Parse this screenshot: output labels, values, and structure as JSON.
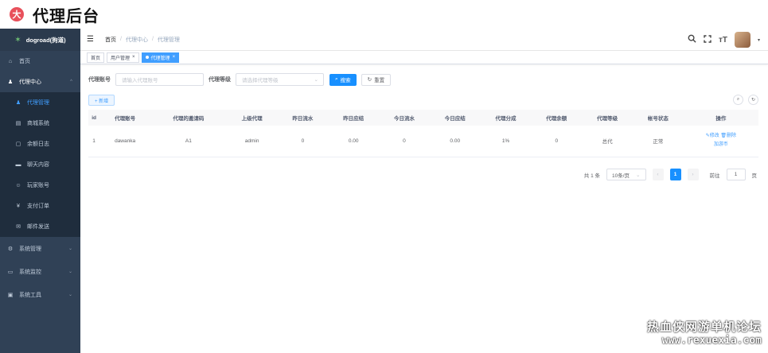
{
  "header": {
    "logo_char": "大",
    "title": "代理后台"
  },
  "sidebar": {
    "brand": "dogroad(狗道)",
    "items": [
      {
        "label": "首页",
        "icon": "dashboard-icon",
        "glyph": "⌂"
      },
      {
        "label": "代理中心",
        "icon": "user-icon",
        "glyph": "♟",
        "arrow": "^"
      },
      {
        "label": "系统管理",
        "icon": "gear-icon",
        "glyph": "⚙",
        "arrow": "⌄"
      },
      {
        "label": "系统监控",
        "icon": "monitor-icon",
        "glyph": "▭",
        "arrow": "⌄"
      },
      {
        "label": "系统工具",
        "icon": "toolbox-icon",
        "glyph": "▣",
        "arrow": "⌄"
      }
    ],
    "sub_items": [
      {
        "label": "代理管理",
        "icon": "user-icon",
        "glyph": "♟"
      },
      {
        "label": "商城系统",
        "icon": "cart-icon",
        "glyph": "▤"
      },
      {
        "label": "余额日志",
        "icon": "log-icon",
        "glyph": "▢"
      },
      {
        "label": "聊天内容",
        "icon": "chat-icon",
        "glyph": "▬"
      },
      {
        "label": "玩家账号",
        "icon": "player-icon",
        "glyph": "☺"
      },
      {
        "label": "支付订单",
        "icon": "yen-icon",
        "glyph": "¥"
      },
      {
        "label": "邮件发送",
        "icon": "mail-icon",
        "glyph": "✉"
      }
    ]
  },
  "topbar": {
    "breadcrumb": [
      "首页",
      "代理中心",
      "代理管理"
    ],
    "separator": "/"
  },
  "tags": {
    "items": [
      "首页",
      "用户管理"
    ],
    "active": "代理管理",
    "close": "×"
  },
  "filter": {
    "account_label": "代理账号",
    "account_placeholder": "请输入代理账号",
    "level_label": "代理等级",
    "level_placeholder": "请选择代理等级",
    "search_btn": "搜索",
    "reset_btn": "重置"
  },
  "toolbar": {
    "add_btn": "+ 新增"
  },
  "table": {
    "columns": [
      "id",
      "代理账号",
      "代理的邀请码",
      "上级代理",
      "昨日流水",
      "昨日应结",
      "今日流水",
      "今日应结",
      "代理分成",
      "代理余额",
      "代理等级",
      "帐号状态",
      "操作"
    ],
    "rows": [
      {
        "id": "1",
        "account": "dawanka",
        "invite": "A1",
        "parent": "admin",
        "yday_flow": "0",
        "yday_settle": "0.00",
        "today_flow": "0",
        "today_settle": "0.00",
        "share": "1%",
        "balance": "0",
        "level": "总代",
        "status": "正常",
        "op_edit": "修改",
        "op_delete": "删除",
        "op_add_coin": "加游币"
      }
    ]
  },
  "pagination": {
    "total": "共 1 条",
    "page_size": "10条/页",
    "current": "1",
    "goto_label": "前往",
    "goto_value": "1",
    "page_unit": "页"
  },
  "watermark": {
    "line1": "热血侠网游单机论坛",
    "line2": "www.rexuexia.com"
  }
}
